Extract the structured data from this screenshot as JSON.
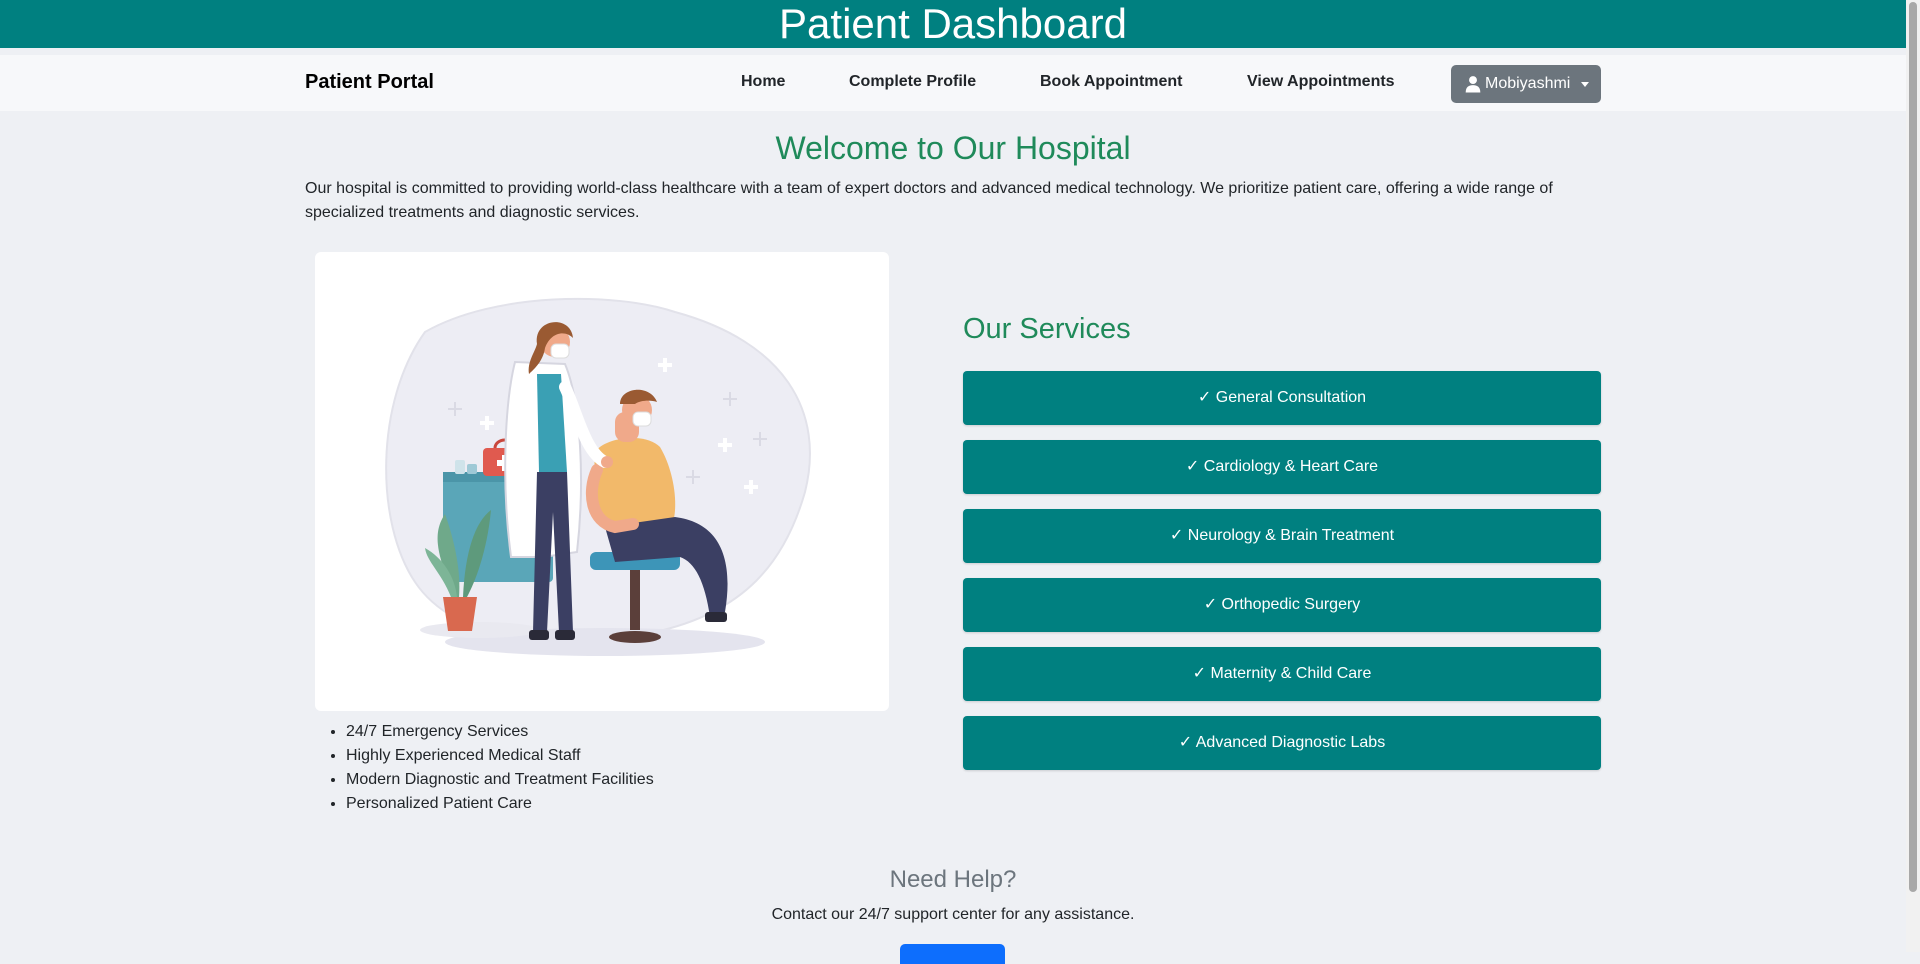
{
  "header": {
    "title": "Patient Dashboard"
  },
  "navbar": {
    "brand": "Patient Portal",
    "links": [
      "Home",
      "Complete Profile",
      "Book Appointment",
      "View Appointments"
    ],
    "user": {
      "name": "Mobiyashmi",
      "icon": "user-icon"
    }
  },
  "main": {
    "welcome_title": "Welcome to Our Hospital",
    "intro": "Our hospital is committed to providing world-class healthcare with a team of expert doctors and advanced medical technology. We prioritize patient care, offering a wide range of specialized treatments and diagnostic services.",
    "features": [
      "24/7 Emergency Services",
      "Highly Experienced Medical Staff",
      "Modern Diagnostic and Treatment Facilities",
      "Personalized Patient Care"
    ],
    "services_title": "Our Services",
    "services": [
      "✓ General Consultation",
      "✓ Cardiology & Heart Care",
      "✓ Neurology & Brain Treatment",
      "✓ Orthopedic Surgery",
      "✓ Maternity & Child Care",
      "✓ Advanced Diagnostic Labs"
    ]
  },
  "help": {
    "title": "Need Help?",
    "text": "Contact our 24/7 support center for any assistance."
  },
  "colors": {
    "primary_teal": "#008080",
    "heading_green": "#1f8a5a",
    "user_button": "#6c757d",
    "help_button": "#0d6efd"
  }
}
